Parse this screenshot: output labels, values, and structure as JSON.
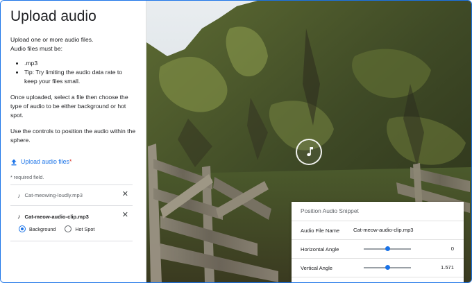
{
  "left_panel": {
    "title": "Upload audio",
    "intro_line1": "Upload one or more audio files.",
    "intro_line2": "Audio files must be:",
    "requirements": [
      ".mp3",
      "Tip: Try limiting the audio data rate to keep your files small."
    ],
    "select_help": "Once uploaded, select a file then choose the type of audio to be either background or hot spot.",
    "controls_help": "Use the controls to position the audio within the sphere.",
    "upload_label": "Upload audio files",
    "required_star": "*",
    "required_note": "* required field.",
    "files": [
      {
        "name": "Cat-meowing-loudly.mp3",
        "selected": false,
        "remove_label": "✕"
      },
      {
        "name": "Cat-meow-audio-clip.mp3",
        "selected": true,
        "remove_label": "✕"
      }
    ],
    "audio_types": [
      {
        "label": "Background",
        "checked": true
      },
      {
        "label": "Hot Spot",
        "checked": false
      }
    ]
  },
  "position_panel": {
    "title": "Position Audio Snippet",
    "file_label": "Audio File Name",
    "file_value": "Cat-meow-audio-clip.mp3",
    "horizontal_label": "Horizontal Angle",
    "horizontal_value": "0",
    "horizontal_fraction": 0.5,
    "vertical_label": "Vertical Angle",
    "vertical_value": "1.571",
    "vertical_fraction": 0.5
  },
  "icons": {
    "upload": "upload-icon",
    "music_note": "music-note-icon",
    "close": "close-icon"
  },
  "colors": {
    "accent": "#1a73e8",
    "required": "#d93025"
  }
}
